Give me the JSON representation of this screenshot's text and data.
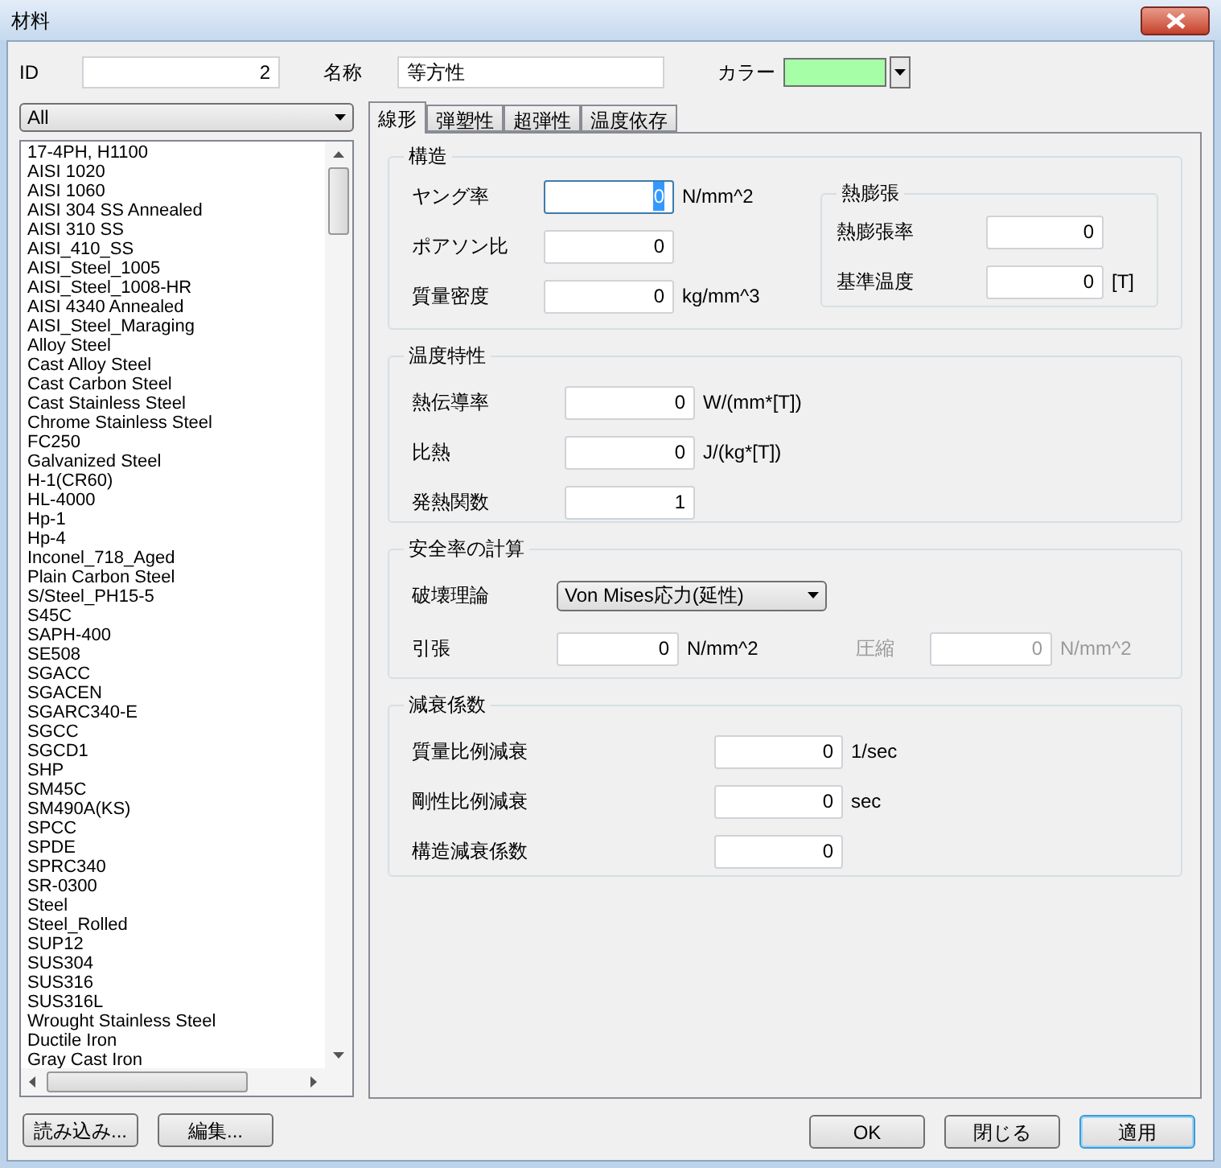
{
  "window": {
    "title": "材料"
  },
  "id": {
    "label": "ID",
    "value": "2"
  },
  "name": {
    "label": "名称",
    "value": "等方性"
  },
  "color": {
    "label": "カラー",
    "color": "#a6ffa6"
  },
  "filter": {
    "value": "All"
  },
  "materials": [
    "17-4PH, H1100",
    "AISI 1020",
    "AISI 1060",
    "AISI 304 SS Annealed",
    "AISI 310 SS",
    "AISI_410_SS",
    "AISI_Steel_1005",
    "AISI_Steel_1008-HR",
    "AISI 4340 Annealed",
    "AISI_Steel_Maraging",
    "Alloy Steel",
    "Cast Alloy Steel",
    "Cast Carbon Steel",
    "Cast Stainless Steel",
    "Chrome Stainless Steel",
    "FC250",
    "Galvanized Steel",
    "H-1(CR60)",
    "HL-4000",
    "Hp-1",
    "Hp-4",
    "Inconel_718_Aged",
    "Plain Carbon Steel",
    "S/Steel_PH15-5",
    "S45C",
    "SAPH-400",
    "SE508",
    "SGACC",
    "SGACEN",
    "SGARC340-E",
    "SGCC",
    "SGCD1",
    "SHP",
    "SM45C",
    "SM490A(KS)",
    "SPCC",
    "SPDE",
    "SPRC340",
    "SR-0300",
    "Steel",
    "Steel_Rolled",
    "SUP12",
    "SUS304",
    "SUS316",
    "SUS316L",
    "Wrought Stainless Steel",
    "Ductile Iron",
    "Gray Cast Iron"
  ],
  "tabs": [
    {
      "label": "線形",
      "selected": true
    },
    {
      "label": "弾塑性",
      "selected": false
    },
    {
      "label": "超弾性",
      "selected": false
    },
    {
      "label": "温度依存",
      "selected": false
    }
  ],
  "structure": {
    "title": "構造",
    "rows": [
      {
        "label": "ヤング率",
        "value": "0",
        "unit": "N/mm^2",
        "focused": true
      },
      {
        "label": "ポアソン比",
        "value": "0",
        "focused": false
      },
      {
        "label": "質量密度",
        "value": "0",
        "unit": "kg/mm^3",
        "focused": false
      }
    ],
    "thermal_expansion": {
      "title": "熱膨張",
      "rows": [
        {
          "label": "熱膨張率",
          "value": "0"
        },
        {
          "label": "基準温度",
          "value": "0",
          "unit": "[T]"
        }
      ]
    }
  },
  "temperature": {
    "title": "温度特性",
    "rows": [
      {
        "label": "熱伝導率",
        "value": "0",
        "unit": "W/(mm*[T])"
      },
      {
        "label": "比熱",
        "value": "0",
        "unit": "J/(kg*[T])"
      },
      {
        "label": "発熱関数",
        "value": "1"
      }
    ]
  },
  "safety": {
    "title": "安全率の計算",
    "theory": {
      "label": "破壊理論",
      "value": "Von Mises応力(延性)"
    },
    "tension": {
      "label": "引張",
      "value": "0",
      "unit": "N/mm^2",
      "disabled": false
    },
    "compression": {
      "label": "圧縮",
      "value": "0",
      "unit": "N/mm^2",
      "disabled": true
    }
  },
  "damping": {
    "title": "減衰係数",
    "rows": [
      {
        "label": "質量比例減衰",
        "value": "0",
        "unit": "1/sec"
      },
      {
        "label": "剛性比例減衰",
        "value": "0",
        "unit": "sec"
      },
      {
        "label": "構造減衰係数",
        "value": "0"
      }
    ]
  },
  "left_buttons": [
    "読み込み...",
    "編集..."
  ],
  "right_buttons": [
    {
      "label": "OK",
      "default": false
    },
    {
      "label": "閉じる",
      "default": false
    },
    {
      "label": "適用",
      "default": true
    }
  ]
}
